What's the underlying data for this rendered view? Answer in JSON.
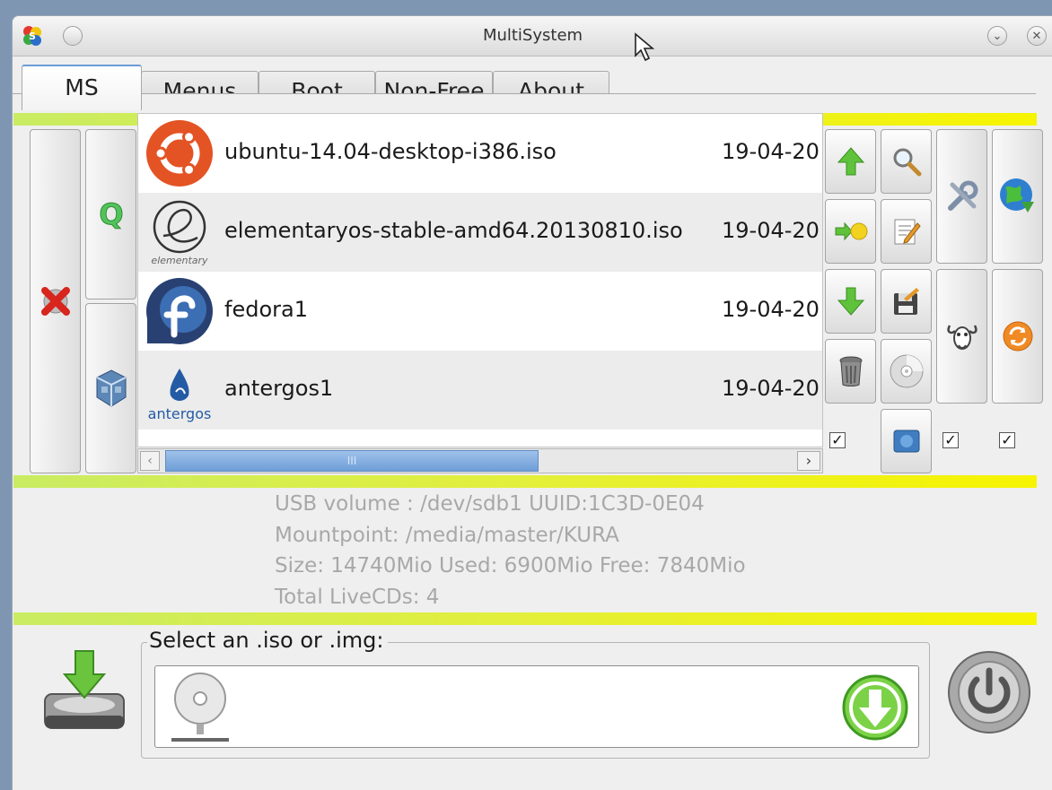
{
  "window": {
    "title": "MultiSystem",
    "app_icon": "multisystem-icon",
    "controls": [
      "minimize-icon",
      "close-icon"
    ]
  },
  "tabs": [
    {
      "label": "MS",
      "active": true
    },
    {
      "label": "Menus",
      "active": false
    },
    {
      "label": "Boot",
      "active": false
    },
    {
      "label": "Non-Free",
      "active": false
    },
    {
      "label": "About",
      "active": false
    }
  ],
  "left_buttons": [
    {
      "icon": "delete-red-x-icon"
    },
    {
      "icon": "qemu-q-icon"
    },
    {
      "icon": "virtualbox-icon"
    }
  ],
  "iso_list": [
    {
      "logo": "ubuntu-logo",
      "name": "ubuntu-14.04-desktop-i386.iso",
      "date": "19-04-20"
    },
    {
      "logo": "elementary-logo",
      "logo_text": "elementary",
      "name": "elementaryos-stable-amd64.20130810.iso",
      "date": "19-04-20"
    },
    {
      "logo": "fedora-logo",
      "name": "fedora1",
      "date": "19-04-20"
    },
    {
      "logo": "antergos-logo",
      "logo_text": "antergos",
      "name": "antergos1",
      "date": "19-04-20"
    }
  ],
  "scrollbar": {
    "thumb_grip": "III",
    "left_arrow": "‹",
    "right_arrow": "›"
  },
  "action_buttons": [
    {
      "icon": "move-up-arrow-icon"
    },
    {
      "icon": "search-magnifier-icon"
    },
    {
      "icon": "tools-wrench-icon"
    },
    {
      "icon": "globe-download-icon"
    },
    {
      "icon": "bulb-arrow-icon"
    },
    {
      "icon": "edit-notepad-icon"
    },
    {
      "icon": "move-down-arrow-icon"
    },
    {
      "icon": "floppy-edit-icon"
    },
    {
      "icon": "gnu-icon"
    },
    {
      "icon": "refresh-orange-icon"
    },
    {
      "icon": "trash-can-icon"
    },
    {
      "icon": "cd-disc-icon"
    },
    {
      "icon": "grub-flag-icon"
    }
  ],
  "checkboxes": [
    true,
    true,
    true
  ],
  "info": {
    "line1": "USB volume : /dev/sdb1 UUID:1C3D-0E04",
    "line2": "Mountpoint: /media/master/KURA",
    "line3": "Size: 14740Mio Used: 6900Mio Free: 7840Mio",
    "line4": "Total LiveCDs: 4"
  },
  "select": {
    "label": "Select an .iso or .img:",
    "field_value": ""
  },
  "colors": {
    "green_bar_start": "#c9ec63",
    "green_bar_end": "#f7f400",
    "tab_accent": "#6b9cd6",
    "ubuntu": "#e45324",
    "fedora": "#294172"
  }
}
